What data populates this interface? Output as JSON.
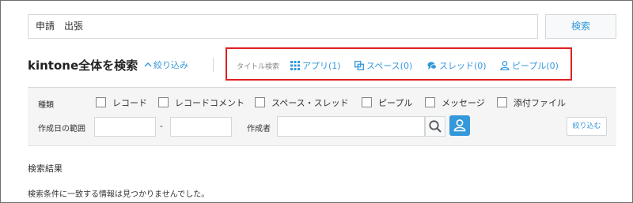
{
  "search": {
    "query_value": "申請　出張",
    "button_label": "検索"
  },
  "header": {
    "title": "kintone全体を検索",
    "narrow_link_label": "絞り込み"
  },
  "title_search": {
    "label": "タイトル検索",
    "links": [
      {
        "label": "アプリ(1)",
        "icon": "grid-icon"
      },
      {
        "label": "スペース(0)",
        "icon": "space-icon"
      },
      {
        "label": "スレッド(0)",
        "icon": "thread-icon"
      },
      {
        "label": "ピープル(0)",
        "icon": "person-icon"
      }
    ],
    "highlight_color": "#e02020"
  },
  "filters": {
    "type_label": "種類",
    "types": [
      "レコード",
      "レコードコメント",
      "スペース・スレッド",
      "ピープル",
      "メッセージ",
      "添付ファイル"
    ],
    "date_range_label": "作成日の範囲",
    "date_from": "",
    "date_to": "",
    "date_separator": "-",
    "creator_label": "作成者",
    "creator_value": "",
    "narrow_button_label": "絞り込む"
  },
  "results": {
    "heading": "検索結果",
    "message": "検索条件に一致する情報は見つかりませんでした。"
  },
  "colors": {
    "accent": "#3498db",
    "highlight": "#e02020"
  }
}
